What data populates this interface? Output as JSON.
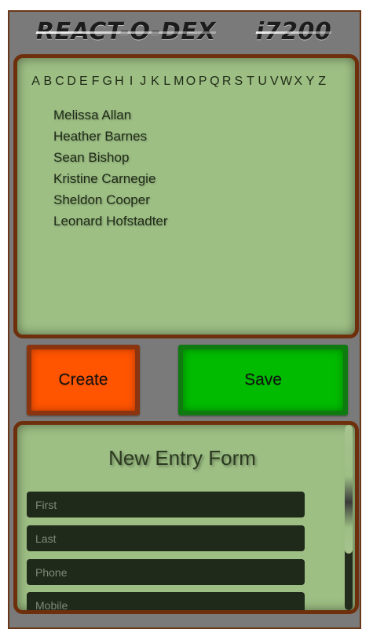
{
  "header": {
    "brand": "REACT-O-DEX",
    "model": "i7200"
  },
  "alphabet": [
    "A",
    "B",
    "C",
    "D",
    "E",
    "F",
    "G",
    "H",
    "I",
    "J",
    "K",
    "L",
    "M",
    "O",
    "P",
    "Q",
    "R",
    "S",
    "T",
    "U",
    "V",
    "W",
    "X",
    "Y",
    "Z"
  ],
  "contacts": [
    "Melissa Allan",
    "Heather Barnes",
    "Sean Bishop",
    "Kristine Carnegie",
    "Sheldon Cooper",
    "Leonard Hofstadter"
  ],
  "buttons": {
    "create_label": "Create",
    "save_label": "Save"
  },
  "form": {
    "title": "New Entry Form",
    "first_placeholder": "First",
    "last_placeholder": "Last",
    "phone_placeholder": "Phone",
    "mobile_placeholder": "Mobile"
  },
  "colors": {
    "device": "#7a7a7a",
    "screen": "#9dbf84",
    "screen_border": "#6e2f0d",
    "create": "#ff5500",
    "save": "#00bb00",
    "input_bg": "#202a1b"
  }
}
